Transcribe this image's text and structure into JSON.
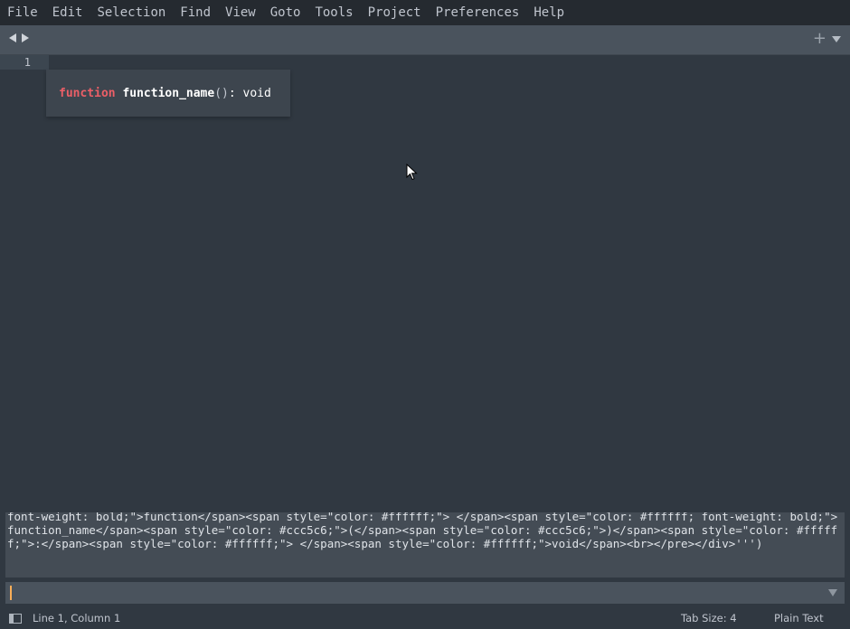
{
  "menu": {
    "items": [
      "File",
      "Edit",
      "Selection",
      "Find",
      "View",
      "Goto",
      "Tools",
      "Project",
      "Preferences",
      "Help"
    ]
  },
  "tabbar": {
    "back_icon": "triangle-left",
    "forward_icon": "triangle-right",
    "new_tab": "+",
    "menu_icon": "triangle-down"
  },
  "editor": {
    "line_number": "1",
    "popup": {
      "keyword": "function",
      "name": "function_name",
      "parens": "()",
      "colon": ":",
      "return_type": "void"
    }
  },
  "console": {
    "text": "font-weight: bold;\">function</span><span style=\"color: #ffffff;\"> </span><span style=\"color: #ffffff; font-weight: bold;\">function_name</span><span style=\"color: #ccc5c6;\">(</span><span style=\"color: #ccc5c6;\">)</span><span style=\"color: #ffffff;\">:</span><span style=\"color: #ffffff;\"> </span><span style=\"color: #ffffff;\">void</span><br></pre></div>''')"
  },
  "input": {
    "value": ""
  },
  "status": {
    "position": "Line 1, Column 1",
    "tab_size": "Tab Size: 4",
    "syntax": "Plain Text"
  },
  "colors": {
    "background": "#303841",
    "keyword": "#ec5f67",
    "caret": "#f9ae58"
  }
}
